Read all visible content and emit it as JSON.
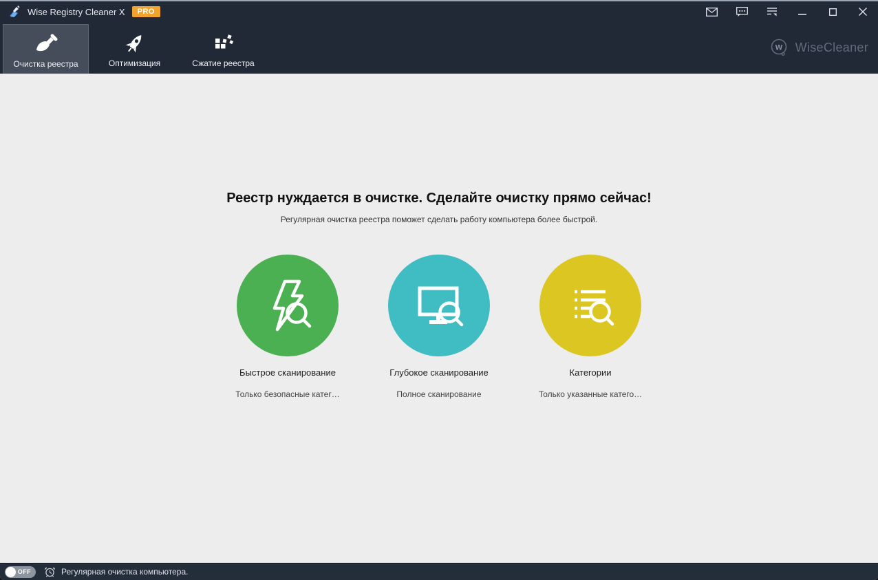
{
  "window": {
    "title": "Wise Registry Cleaner X",
    "badge": "PRO"
  },
  "titlebar": {
    "icons": [
      "mail-icon",
      "feedback-chat-icon",
      "menu-icon",
      "minimize-icon",
      "maximize-icon",
      "close-icon"
    ]
  },
  "nav": {
    "tabs": [
      {
        "label": "Очистка реестра",
        "icon": "brush-icon",
        "active": true
      },
      {
        "label": "Оптимизация",
        "icon": "rocket-icon",
        "active": false
      },
      {
        "label": "Сжатие реестра",
        "icon": "defrag-blocks-icon",
        "active": false
      }
    ],
    "brand": "WiseCleaner",
    "brand_letter": "W"
  },
  "main": {
    "heading": "Реестр нуждается в очистке. Сделайте очистку прямо сейчас!",
    "subheading": "Регулярная очистка реестра поможет сделать работу компьютера более быстрой.",
    "options": [
      {
        "label": "Быстрое сканирование",
        "description": "Только безопасные катег…",
        "color": "#4bb051",
        "icon": "lightning-search-icon"
      },
      {
        "label": "Глубокое сканирование",
        "description": "Полное сканирование",
        "color": "#3fbdc3",
        "icon": "monitor-search-icon"
      },
      {
        "label": "Категории",
        "description": "Только указанные катего…",
        "color": "#dcc722",
        "icon": "list-search-icon"
      }
    ]
  },
  "statusbar": {
    "toggle_state": "OFF",
    "text": "Регулярная очистка компьютера."
  },
  "colors": {
    "titlebar_bg": "#222936",
    "active_tab_bg": "#454d5a",
    "content_bg": "#ededed",
    "pro_badge": "#f1a32f",
    "quick_scan": "#4bb051",
    "deep_scan": "#3fbdc3",
    "categories": "#dcc722"
  }
}
